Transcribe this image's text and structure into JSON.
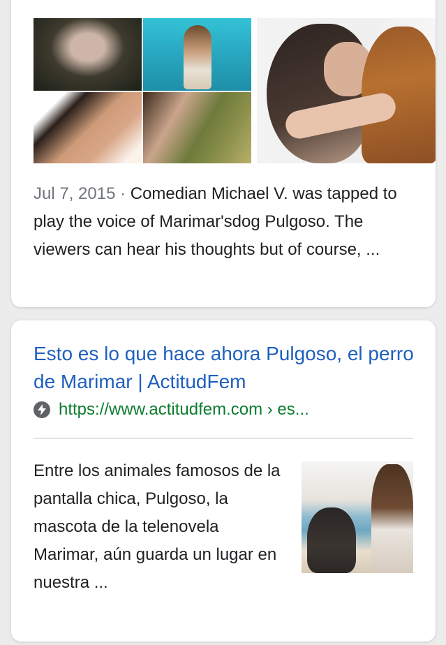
{
  "result1": {
    "date": "Jul 7, 2015",
    "separator": " · ",
    "snippet": "Comedian Michael V. was tapped to play the voice of Marimar'sdog Pulgoso. The viewers can hear his thoughts but of course, ..."
  },
  "result2": {
    "title": "Esto es lo que hace ahora Pulgoso, el perro de Marimar | ActitudFem",
    "url": "https://www.actitudfem.com › es...",
    "amp_icon": "lightning-bolt-icon",
    "snippet": "Entre los animales famosos de la pantalla chica, Pulgoso, la mascota de la telenovela Marimar, aún guarda un lugar en nuestra ..."
  },
  "colors": {
    "title_link": "#1f5fbf",
    "url_green": "#0b7c2f",
    "date_gray": "#70757a",
    "text": "#202124"
  }
}
